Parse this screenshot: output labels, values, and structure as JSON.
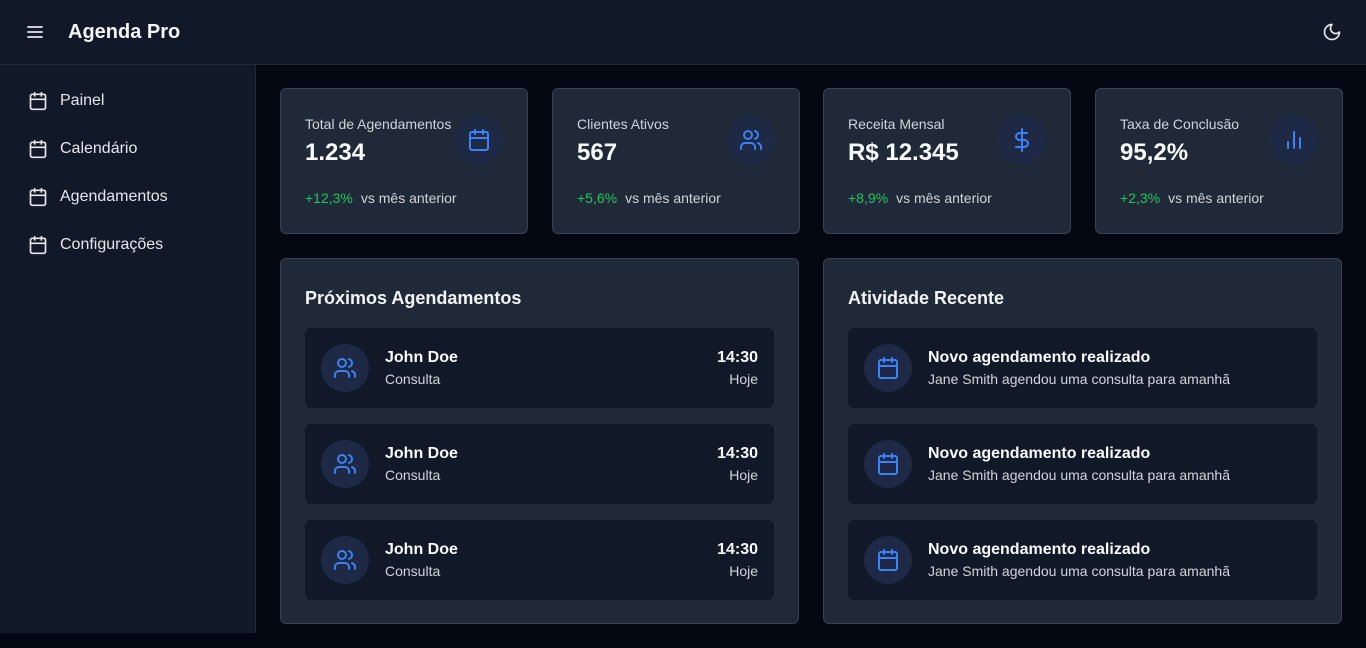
{
  "app": {
    "title": "Agenda Pro",
    "menu_icon": "menu-icon",
    "theme_icon": "moon-icon"
  },
  "colors": {
    "accent": "#3b82f6",
    "positive": "#22c55e",
    "background": "#030712",
    "card": "#1f2937",
    "surface": "#111827"
  },
  "sidebar": {
    "items": [
      {
        "label": "Painel",
        "icon": "calendar-icon"
      },
      {
        "label": "Calendário",
        "icon": "calendar-icon"
      },
      {
        "label": "Agendamentos",
        "icon": "calendar-icon"
      },
      {
        "label": "Configurações",
        "icon": "calendar-icon"
      }
    ]
  },
  "stats": [
    {
      "label": "Total de Agendamentos",
      "value": "1.234",
      "change": "+12,3%",
      "comparison": "vs mês anterior",
      "icon": "calendar-icon"
    },
    {
      "label": "Clientes Ativos",
      "value": "567",
      "change": "+5,6%",
      "comparison": "vs mês anterior",
      "icon": "users-icon"
    },
    {
      "label": "Receita Mensal",
      "value": "R$ 12.345",
      "change": "+8,9%",
      "comparison": "vs mês anterior",
      "icon": "dollar-icon"
    },
    {
      "label": "Taxa de Conclusão",
      "value": "95,2%",
      "change": "+2,3%",
      "comparison": "vs mês anterior",
      "icon": "bar-chart-icon"
    }
  ],
  "upcoming": {
    "title": "Próximos Agendamentos",
    "items": [
      {
        "name": "John Doe",
        "type": "Consulta",
        "time": "14:30",
        "day": "Hoje",
        "icon": "users-icon"
      },
      {
        "name": "John Doe",
        "type": "Consulta",
        "time": "14:30",
        "day": "Hoje",
        "icon": "users-icon"
      },
      {
        "name": "John Doe",
        "type": "Consulta",
        "time": "14:30",
        "day": "Hoje",
        "icon": "users-icon"
      }
    ]
  },
  "activity": {
    "title": "Atividade Recente",
    "items": [
      {
        "title": "Novo agendamento realizado",
        "detail": "Jane Smith agendou uma consulta para amanhã",
        "icon": "calendar-icon"
      },
      {
        "title": "Novo agendamento realizado",
        "detail": "Jane Smith agendou uma consulta para amanhã",
        "icon": "calendar-icon"
      },
      {
        "title": "Novo agendamento realizado",
        "detail": "Jane Smith agendou uma consulta para amanhã",
        "icon": "calendar-icon"
      }
    ]
  }
}
